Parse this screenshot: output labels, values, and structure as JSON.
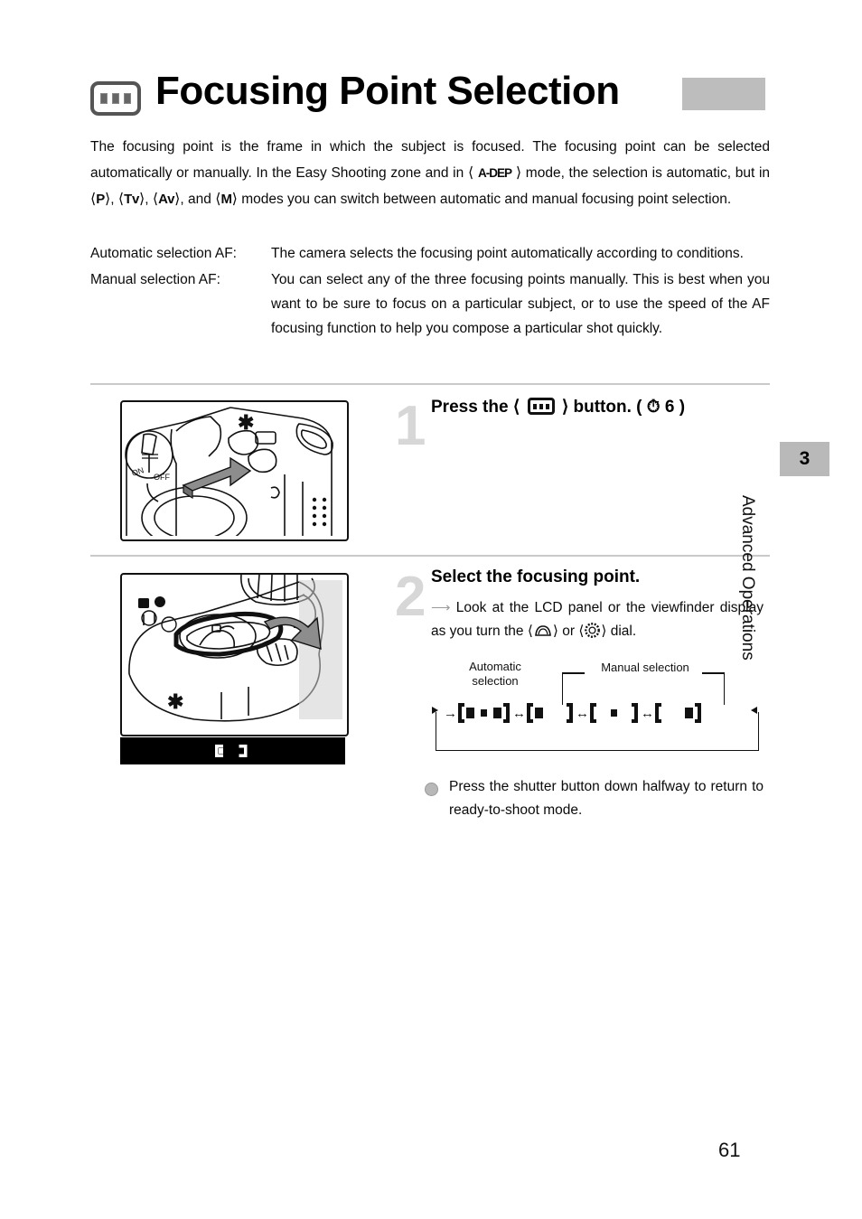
{
  "title": {
    "text": "Focusing Point Selection",
    "icon": "focus-point-button-icon"
  },
  "intro": {
    "line1": "The focusing point is the frame in which the subject is focused. The focusing point can be selected automatically or manually. In the Easy Shooting zone and in ⟨ A-DEP ⟩ mode, the selection is automatic, but in ⟨ P ⟩, ⟨ Tv ⟩, ⟨ Av ⟩, and ⟨ M ⟩ modes you can switch between automatic and manual focusing point selection.",
    "seg_a": "The focusing point is the frame in which the subject is focused. The focusing point can be selected automatically or manually. In the Easy Shooting zone and in ",
    "mode_adep": "A-DEP",
    "seg_b": " mode, the selection is automatic, but in ",
    "mode_p": "P",
    "mode_tv": "Tv",
    "mode_av": "Av",
    "mode_m": "M",
    "seg_c": " modes you can switch between automatic and manual focusing point selection."
  },
  "definitions": [
    {
      "term": "Automatic selection AF:",
      "desc": "The camera selects the focusing point automatically according to conditions."
    },
    {
      "term": "Manual selection AF:",
      "desc": "You can select any of the three focusing points manually. This is best when you want to be sure to focus on a particular subject, or to use the speed of the AF focusing function to help you compose a particular shot quickly."
    }
  ],
  "steps": [
    {
      "number": "1",
      "heading_a": "Press the ⟨",
      "heading_icon": "focus-point-button-icon",
      "heading_b": "⟩ button. ( ⏱ 6 )",
      "heading_ref": "( ⟲6 )"
    },
    {
      "number": "2",
      "heading": "Select the focusing point.",
      "note_a": "Look at the LCD panel or the viewfinder display as you turn the ⟨",
      "note_dial1": "main-dial-icon",
      "note_b": "⟩ or ⟨",
      "note_dial2": "quick-control-dial-icon",
      "note_c": "⟩ dial."
    }
  ],
  "cycle_diagram": {
    "label_automatic": "Automatic\nselection",
    "label_automatic_line1": "Automatic",
    "label_automatic_line2": "selection",
    "label_manual": "Manual selection",
    "states": [
      "all-three-points",
      "left-point",
      "center-point",
      "right-point"
    ]
  },
  "shutter_note": "Press the shutter button down halfway to return to ready-to-shoot mode.",
  "lcd_display": {
    "label": "focus-point-lcd-left-selected"
  },
  "sidebar": {
    "chapter_number": "3",
    "chapter_title": "Advanced Operations"
  },
  "page_number": "61",
  "colors": {
    "title_bar_gray": "#bdbdbd",
    "chapter_gray": "#b9b9b9",
    "rule_gray": "#c9c9c9",
    "step_number_gray": "#d7d7d7"
  }
}
